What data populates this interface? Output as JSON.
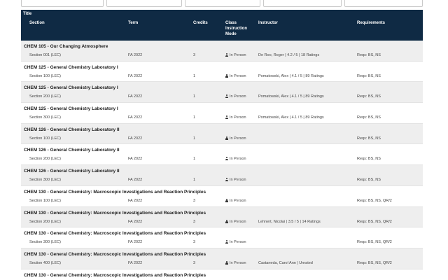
{
  "headers": {
    "title": "Title",
    "section": "Section",
    "term": "Term",
    "credits": "Credits",
    "mode": "Class Instruction Mode",
    "instructor": "Instructor",
    "requirements": "Requirements"
  },
  "icons": {
    "mode_icon": "person-icon"
  },
  "rows": [
    {
      "course": "CHEM 105 - Our Changing Atmosphere",
      "section": "Section 001 (LEC)",
      "term": "FA 2022",
      "credits": "3",
      "mode": "In Person",
      "instructor": "De Roo, Roger | 4.2 / 5 | 18 Ratings",
      "requirements": "Reqs: BS, NS"
    },
    {
      "course": "CHEM 125 - General Chemistry Laboratory I",
      "section": "Section 100 (LEC)",
      "term": "FA 2022",
      "credits": "1",
      "mode": "In Person",
      "instructor": "Pomatowski, Alex | 4.1 / 5 | 89 Ratings",
      "requirements": "Reqs: BS, NS"
    },
    {
      "course": "CHEM 125 - General Chemistry Laboratory I",
      "section": "Section 200 (LEC)",
      "term": "FA 2022",
      "credits": "1",
      "mode": "In Person",
      "instructor": "Pomatowski, Alex | 4.1 / 5 | 89 Ratings",
      "requirements": "Reqs: BS, NS"
    },
    {
      "course": "CHEM 125 - General Chemistry Laboratory I",
      "section": "Section 300 (LEC)",
      "term": "FA 2022",
      "credits": "1",
      "mode": "In Person",
      "instructor": "Pomatowski, Alex | 4.1 / 5 | 89 Ratings",
      "requirements": "Reqs: BS, NS"
    },
    {
      "course": "CHEM 126 - General Chemistry Laboratory II",
      "section": "Section 100 (LEC)",
      "term": "FA 2022",
      "credits": "1",
      "mode": "In Person",
      "instructor": "",
      "requirements": "Reqs: BS, NS"
    },
    {
      "course": "CHEM 126 - General Chemistry Laboratory II",
      "section": "Section 200 (LEC)",
      "term": "FA 2022",
      "credits": "1",
      "mode": "In Person",
      "instructor": "",
      "requirements": "Reqs: BS, NS"
    },
    {
      "course": "CHEM 126 - General Chemistry Laboratory II",
      "section": "Section 300 (LEC)",
      "term": "FA 2022",
      "credits": "1",
      "mode": "In Person",
      "instructor": "",
      "requirements": "Reqs: BS, NS"
    },
    {
      "course": "CHEM 130 - General Chemistry: Macroscopic Investigations and Reaction Principles",
      "section": "Section 100 (LEC)",
      "term": "FA 2022",
      "credits": "3",
      "mode": "In Person",
      "instructor": "",
      "requirements": "Reqs: BS, NS, QR/2"
    },
    {
      "course": "CHEM 130 - General Chemistry: Macroscopic Investigations and Reaction Principles",
      "section": "Section 200 (LEC)",
      "term": "FA 2022",
      "credits": "3",
      "mode": "In Person",
      "instructor": "Lehnert, Nicolai | 3.5 / 5 | 14 Ratings",
      "requirements": "Reqs: BS, NS, QR/2"
    },
    {
      "course": "CHEM 130 - General Chemistry: Macroscopic Investigations and Reaction Principles",
      "section": "Section 300 (LEC)",
      "term": "FA 2022",
      "credits": "3",
      "mode": "In Person",
      "instructor": "",
      "requirements": "Reqs: BS, NS, QR/2"
    },
    {
      "course": "CHEM 130 - General Chemistry: Macroscopic Investigations and Reaction Principles",
      "section": "Section 400 (LEC)",
      "term": "FA 2022",
      "credits": "3",
      "mode": "In Person",
      "instructor": "Castaneda, Carol Ann | Unrated",
      "requirements": "Reqs: BS, NS, QR/2"
    },
    {
      "course": "CHEM 130 - General Chemistry: Macroscopic Investigations and Reaction Principles",
      "section": "",
      "term": "",
      "credits": "",
      "mode": "",
      "instructor": "",
      "requirements": ""
    }
  ]
}
